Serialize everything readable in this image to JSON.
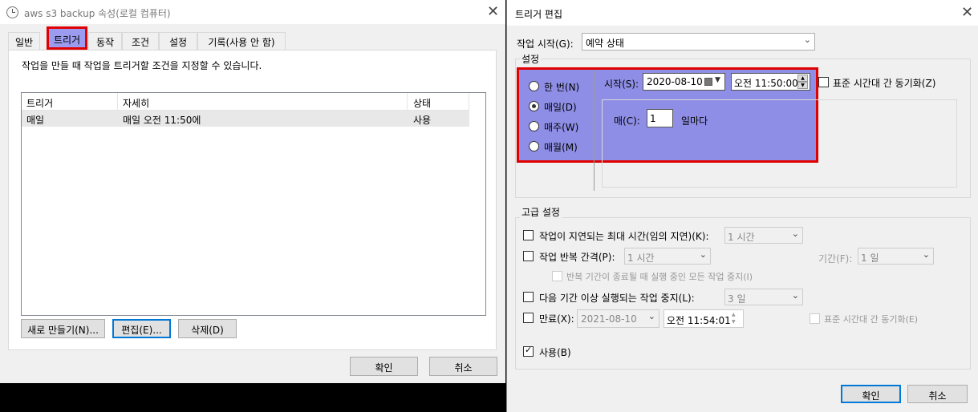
{
  "left_window": {
    "title": "aws s3 backup 속성(로컬 컴퓨터)",
    "tabs": [
      "일반",
      "트리거",
      "동작",
      "조건",
      "설정",
      "기록(사용 안 함)"
    ],
    "description": "작업을 만들 때 작업을 트리거할 조건을 지정할 수 있습니다.",
    "table": {
      "headers": [
        "트리거",
        "자세히",
        "상태"
      ],
      "rows": [
        [
          "매일",
          "매일 오전 11:50에",
          "사용"
        ]
      ]
    },
    "buttons": {
      "new": "새로 만들기(N)...",
      "edit": "편집(E)...",
      "delete": "삭제(D)"
    },
    "ok": "확인",
    "cancel": "취소"
  },
  "right_window": {
    "title": "트리거 편집",
    "begin_task_label": "작업 시작(G):",
    "begin_task_value": "예약 상태",
    "settings_legend": "설정",
    "radios": [
      "한 번(N)",
      "매일(D)",
      "매주(W)",
      "매월(M)"
    ],
    "selected_radio": "매일(D)",
    "start_label": "시작(S):",
    "start_date": "2020-08-10",
    "start_time": "오전 11:50:00",
    "sync_label": "표준 시간대 간 동기화(Z)",
    "recur_label": "매(C):",
    "recur_value": "1",
    "recur_unit": "일마다",
    "advanced_legend": "고급 설정",
    "delay_label": "작업이 지연되는 최대 시간(임의 지연)(K):",
    "delay_value": "1 시간",
    "repeat_label": "작업 반복 간격(P):",
    "repeat_value": "1 시간",
    "duration_label": "기간(F):",
    "duration_value": "1 일",
    "stop_all_label": "반복 기간이 종료될 때 실행 중인 모든 작업 중지(I)",
    "stop_long_label": "다음 기간 이상 실행되는 작업 중지(L):",
    "stop_long_value": "3 일",
    "expire_label": "만료(X):",
    "expire_date": "2021-08-10",
    "expire_time": "오전 11:54:01",
    "expire_sync_label": "표준 시간대 간 동기화(E)",
    "enabled_label": "사용(B)",
    "ok": "확인",
    "cancel": "취소"
  },
  "colors": {
    "highlight": "#e00000",
    "selection_fill": "#8e8ee6",
    "focus_blue": "#0078d7"
  }
}
